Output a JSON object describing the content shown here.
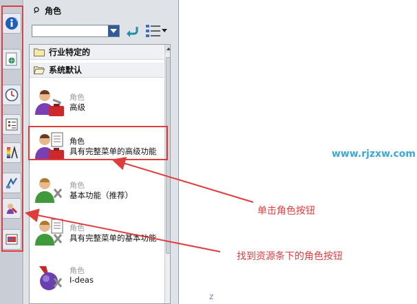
{
  "panel": {
    "title": "角色"
  },
  "folders": [
    {
      "label": "行业特定的"
    },
    {
      "label": "系统默认"
    }
  ],
  "roles": [
    {
      "category": "角色",
      "name": "高级",
      "category_color": "#9a9a9a"
    },
    {
      "category": "角色",
      "name": "具有完整菜单的高级功能",
      "category_color": "#111111"
    },
    {
      "category": "角色",
      "name": "基本功能（推荐）",
      "category_color": "#9a9a9a"
    },
    {
      "category": "角色",
      "name": "具有完整菜单的基本功能",
      "category_color": "#9a9a9a"
    },
    {
      "category": "角色",
      "name": "I-deas",
      "category_color": "#9a9a9a"
    }
  ],
  "resource_bar": {
    "icons": [
      "info-icon",
      "web-browser-icon",
      "history-icon",
      "part-navigator-icon",
      "palette-icon",
      "process-icon",
      "roles-icon",
      "system-materials-icon"
    ]
  },
  "annotations": {
    "click_role": "单击角色按钮",
    "find_role": "找到资源条下的角色按钮"
  },
  "watermark": "www.rjzxw.com",
  "corner_mark": "Z",
  "colors": {
    "accent": "#e23b3b",
    "watermark": "#3aa8e0"
  }
}
